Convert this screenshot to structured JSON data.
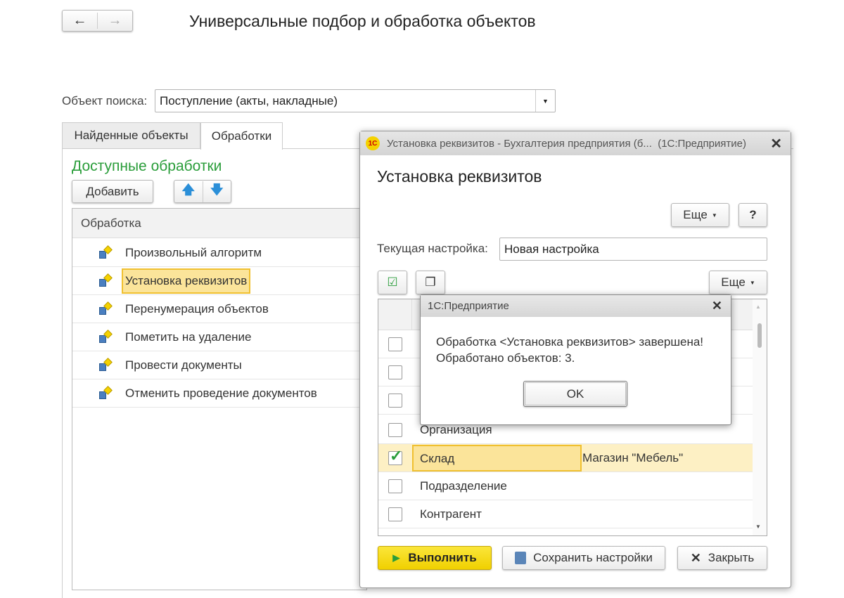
{
  "header": {
    "title": "Универсальные подбор и обработка объектов",
    "back": "←",
    "forward": "→"
  },
  "search": {
    "label": "Объект поиска:",
    "value": "Поступление (акты, накладные)"
  },
  "tabs": [
    {
      "label": "Найденные объекты"
    },
    {
      "label": "Обработки"
    }
  ],
  "processing": {
    "section_title": "Доступные обработки",
    "add_label": "Добавить",
    "column": "Обработка",
    "items": [
      "Произвольный алгоритм",
      "Установка реквизитов",
      "Перенумерация объектов",
      "Пометить на удаление",
      "Провести документы",
      "Отменить проведение документов"
    ]
  },
  "dialog": {
    "window_title": "Установка реквизитов - Бухгалтерия предприятия (б...  (1С:Предприятие)",
    "title": "Установка реквизитов",
    "more_label": "Еще",
    "help_label": "?",
    "setting_label": "Текущая настройка:",
    "setting_value": "Новая настройка",
    "rows": [
      {
        "name": "",
        "value": "",
        "checked": false
      },
      {
        "name": "",
        "value": "",
        "checked": false
      },
      {
        "name": "",
        "value": "",
        "checked": false
      },
      {
        "name": "Организация",
        "value": "",
        "checked": false
      },
      {
        "name": "Склад",
        "value": "Магазин \"Мебель\"",
        "checked": true
      },
      {
        "name": "Подразделение",
        "value": "",
        "checked": false
      },
      {
        "name": "Контрагент",
        "value": "",
        "checked": false
      }
    ],
    "run_label": "Выполнить",
    "save_label": "Сохранить настройки",
    "close_label": "Закрыть"
  },
  "message": {
    "title": "1С:Предприятие",
    "line1": "Обработка <Установка реквизитов> завершена!",
    "line2": "Обработано объектов: 3.",
    "ok_label": "OK"
  },
  "colors": {
    "green": "#2a9d3a",
    "highlight": "#fbe49a",
    "run": "#f5d800"
  }
}
